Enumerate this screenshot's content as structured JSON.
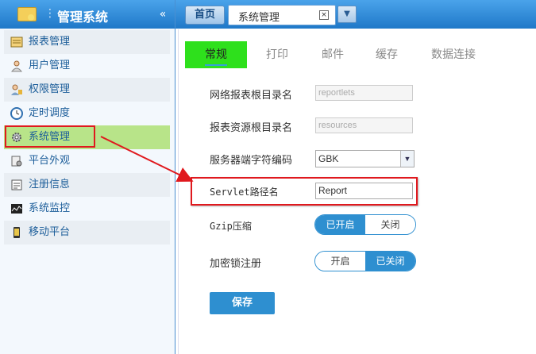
{
  "sidebar": {
    "title": "管理系统",
    "collapse_icon": "«",
    "items": [
      {
        "label": "报表管理",
        "icon": "report-icon"
      },
      {
        "label": "用户管理",
        "icon": "user-icon"
      },
      {
        "label": "权限管理",
        "icon": "permission-icon"
      },
      {
        "label": "定时调度",
        "icon": "clock-icon"
      },
      {
        "label": "系统管理",
        "icon": "gear-icon"
      },
      {
        "label": "平台外观",
        "icon": "appearance-icon"
      },
      {
        "label": "注册信息",
        "icon": "register-icon"
      },
      {
        "label": "系统监控",
        "icon": "monitor-icon"
      },
      {
        "label": "移动平台",
        "icon": "mobile-icon"
      }
    ]
  },
  "tabs": {
    "home": "首页",
    "current": "系统管理",
    "close": "×",
    "dropdown": "▼"
  },
  "subtabs": [
    "常规",
    "打印",
    "邮件",
    "缓存",
    "数据连接"
  ],
  "form": {
    "report_root_label": "网络报表根目录名",
    "report_root_value": "reportlets",
    "resource_root_label": "报表资源根目录名",
    "resource_root_value": "resources",
    "encoding_label": "服务器端字符编码",
    "encoding_value": "GBK",
    "servlet_label": "Servlet路径名",
    "servlet_value": "Report",
    "gzip_label": "Gzip压缩",
    "gzip_on": "已开启",
    "gzip_off": "关闭",
    "lock_label": "加密锁注册",
    "lock_on": "开启",
    "lock_off": "已关闭",
    "save": "保存"
  },
  "colors": {
    "accent": "#2e8fd0",
    "active_menu": "#b8e489",
    "active_subtab": "#2ee01c",
    "annotation": "#e0191e"
  }
}
